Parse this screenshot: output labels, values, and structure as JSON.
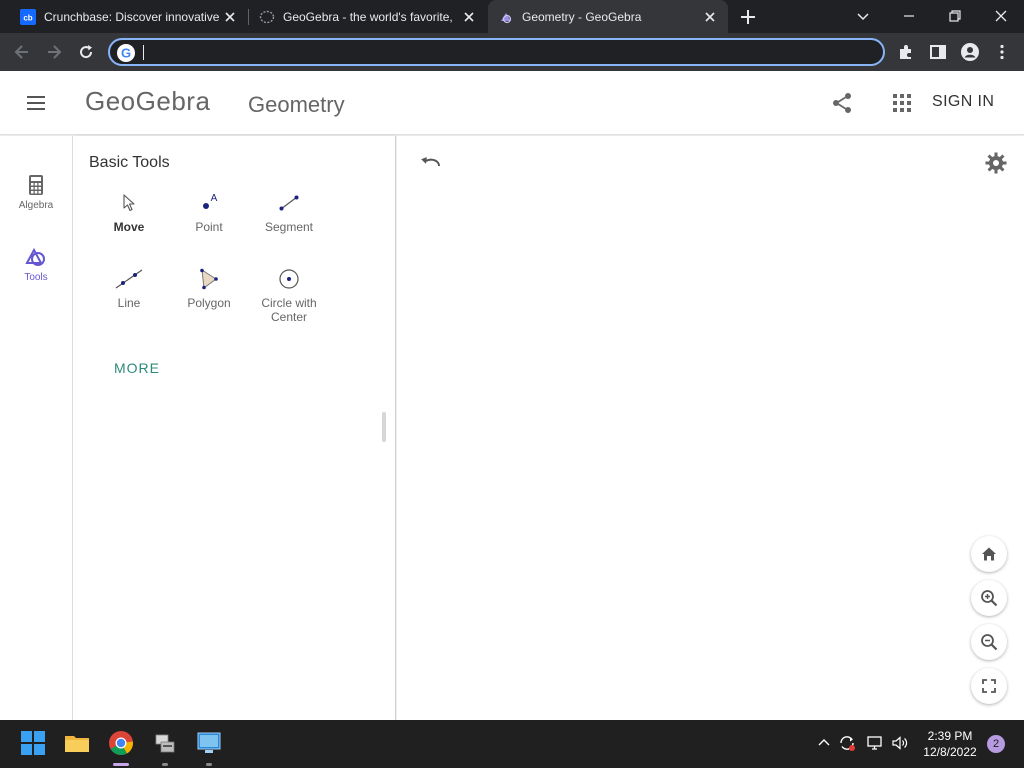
{
  "browser": {
    "tabs": [
      {
        "title": "Crunchbase: Discover innovative",
        "favicon": "crunchbase-icon",
        "active": false
      },
      {
        "title": "GeoGebra - the world's favorite,",
        "favicon": "geogebra-circle-icon",
        "active": false
      },
      {
        "title": "Geometry - GeoGebra",
        "favicon": "geogebra-geometry-icon",
        "active": true
      }
    ],
    "address": {
      "value": "",
      "placeholder": ""
    },
    "colors": {
      "tabbar": "#202124",
      "toolbar": "#35363a",
      "focus_ring": "#8ab4f8"
    }
  },
  "header": {
    "logo_text": "GeoGebra",
    "app_title": "Geometry",
    "sign_in": "SIGN IN"
  },
  "rail": {
    "items": [
      {
        "label": "Algebra",
        "icon": "calculator-icon",
        "active": false
      },
      {
        "label": "Tools",
        "icon": "tools-shapes-icon",
        "active": true
      }
    ],
    "active_color": "#6557d2"
  },
  "panel": {
    "title": "Basic Tools",
    "tools": [
      {
        "label": "Move",
        "icon": "move-cursor-icon",
        "selected": true
      },
      {
        "label": "Point",
        "icon": "point-icon",
        "point_letter": "A",
        "selected": false
      },
      {
        "label": "Segment",
        "icon": "segment-icon",
        "selected": false
      },
      {
        "label": "Line",
        "icon": "line-icon",
        "selected": false
      },
      {
        "label": "Polygon",
        "icon": "polygon-icon",
        "selected": false
      },
      {
        "label": "Circle with Center",
        "label_line1": "Circle with",
        "label_line2": "Center",
        "icon": "circle-center-icon",
        "selected": false
      }
    ],
    "more_label": "MORE"
  },
  "canvas": {
    "controls": [
      "undo-icon",
      "settings-gear-icon",
      "home-icon",
      "zoom-in-icon",
      "zoom-out-icon",
      "fullscreen-icon"
    ]
  },
  "taskbar": {
    "apps": [
      "windows-start-icon",
      "file-explorer-icon",
      "chrome-icon",
      "network-drive-icon",
      "remote-desktop-icon"
    ],
    "time": "2:39 PM",
    "date": "12/8/2022",
    "notification_count": "2"
  }
}
